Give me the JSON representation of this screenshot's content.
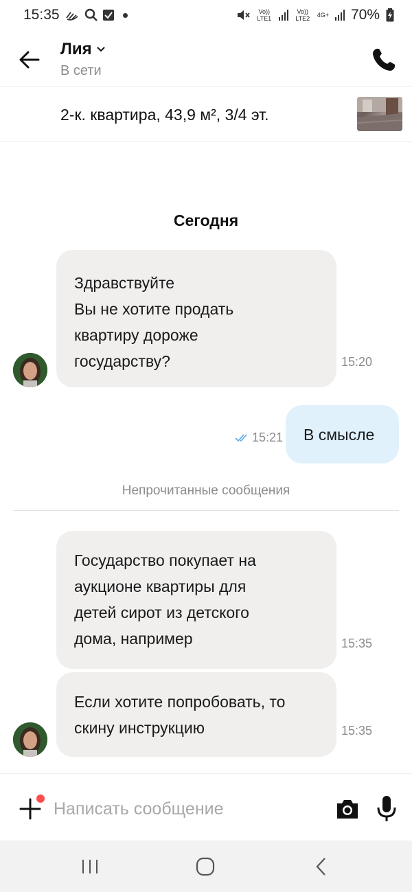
{
  "status_bar": {
    "time": "15:35",
    "battery": "70%",
    "sim1": "Vo)) LTE1",
    "sim2": "Vo)) LTE2",
    "net": "4G+"
  },
  "header": {
    "contact_name": "Лия",
    "presence": "В сети"
  },
  "listing": {
    "title": "2-к. квартира, 43,9 м², 3/4 эт."
  },
  "chat": {
    "day_label": "Сегодня",
    "unread_divider": "Непрочитанные сообщения",
    "messages": [
      {
        "direction": "in",
        "lines": [
          "Здравствуйте",
          "Вы не хотите продать",
          "квартиру дороже",
          "государству?"
        ],
        "time": "15:20"
      },
      {
        "direction": "out",
        "lines": [
          "В смысле"
        ],
        "time": "15:21",
        "read": true
      },
      {
        "direction": "in",
        "lines": [
          "Государство покупает на",
          "аукционе квартиры для",
          "детей сирот из детского",
          "дома, например"
        ],
        "time": "15:35"
      },
      {
        "direction": "in",
        "lines": [
          "Если хотите попробовать, то",
          "скину инструкцию"
        ],
        "time": "15:35"
      }
    ]
  },
  "composer": {
    "placeholder": "Написать сообщение"
  },
  "colors": {
    "incoming_bubble": "#f0efee",
    "outgoing_bubble": "#e0f1fc",
    "read_tick": "#5aa9e6",
    "badge": "#ff4d4d"
  },
  "icons": [
    "back-arrow-icon",
    "chevron-down-icon",
    "phone-icon",
    "double-check-icon",
    "plus-icon",
    "camera-icon",
    "microphone-icon",
    "recents-icon",
    "home-icon",
    "nav-back-icon"
  ]
}
